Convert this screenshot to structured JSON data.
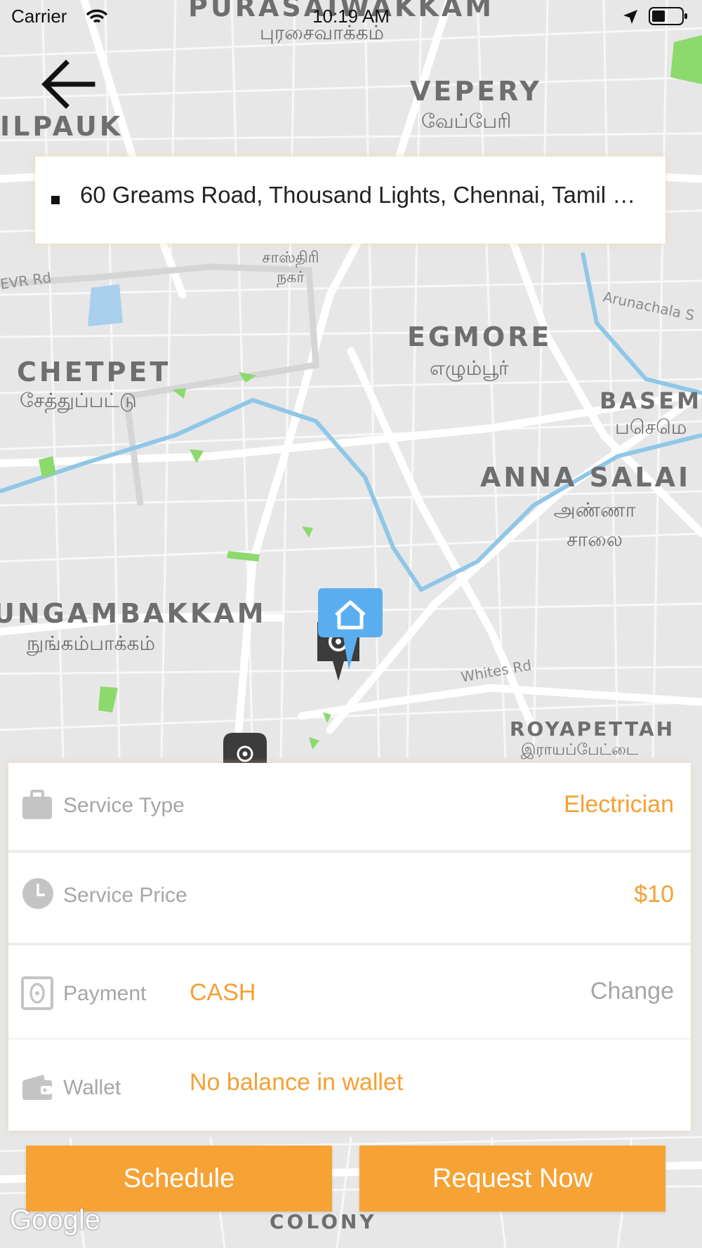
{
  "status_bar": {
    "carrier": "Carrier",
    "time": "10:19 AM"
  },
  "address": {
    "text": "60 Greams Road, Thousand Lights, Chennai, Tamil N..."
  },
  "map": {
    "labels": [
      {
        "en": "PURASAIWAKKAM",
        "ta": "புரசைவாக்கம்"
      },
      {
        "en": "VEPERY",
        "ta": "வேப்பேரி"
      },
      {
        "en": "ILPAUK",
        "ta": ""
      },
      {
        "en": "EGMORE",
        "ta": "எழும்பூர்"
      },
      {
        "en": "CHETPET",
        "ta": "சேத்துப்பட்டு"
      },
      {
        "en": "BASEM",
        "ta": "பசெமெ"
      },
      {
        "en": "ANNA SALAI",
        "ta": "அண்ணா சாலை"
      },
      {
        "en": "UNGAMBAKKAM",
        "ta": "நுங்கம்பாக்கம்"
      },
      {
        "en": "ROYAPETTAH",
        "ta": "இராயப்பேட்டை"
      },
      {
        "en": "COLONY",
        "ta": ""
      }
    ],
    "streets": [
      "EVR Rd",
      "Arunachala S",
      "Whites Rd"
    ],
    "shastri": "சாஸ்திரி நகர்",
    "google": "Google"
  },
  "service_type": {
    "label": "Service Type",
    "value": "Electrician",
    "icon": "briefcase-icon"
  },
  "service_price": {
    "label": "Service Price",
    "value": "$10",
    "icon": "clock-icon"
  },
  "payment": {
    "label": "Payment",
    "value": "CASH",
    "change": "Change",
    "icon": "cash-icon"
  },
  "wallet": {
    "label": "Wallet",
    "value": "No balance in wallet",
    "icon": "wallet-icon"
  },
  "buttons": {
    "schedule": "Schedule",
    "request": "Request Now"
  },
  "colors": {
    "accent": "#f7a234",
    "accent_text": "#f5a033",
    "label_gray": "#a6a6a6",
    "pin_blue": "#5aaef0",
    "pin_dark": "#3c3c3c"
  }
}
